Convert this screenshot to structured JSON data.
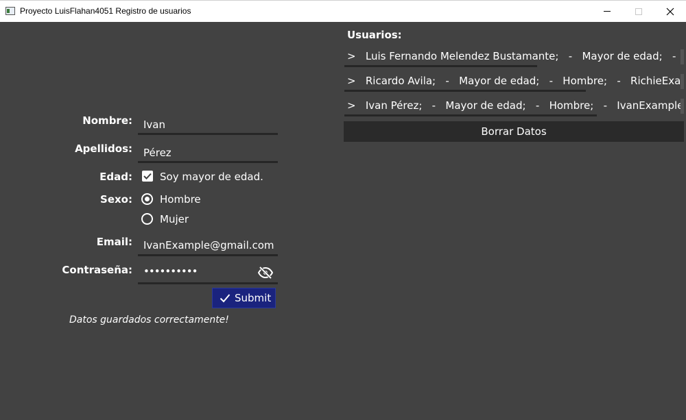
{
  "window": {
    "title": "Proyecto LuisFlahan4051 Registro de usuarios"
  },
  "form": {
    "nombre_label": "Nombre:",
    "nombre_value": "Ivan",
    "apellidos_label": "Apellidos:",
    "apellidos_value": "Pérez",
    "edad_label": "Edad:",
    "edad_option": "Soy mayor de edad.",
    "edad_checked": true,
    "sexo_label": "Sexo:",
    "sexo_options": [
      "Hombre",
      "Mujer"
    ],
    "sexo_selected": "Hombre",
    "email_label": "Email:",
    "email_value": "IvanExample@gmail.com",
    "password_label": "Contraseña:",
    "password_value": "••••••••••",
    "submit_label": "Submit",
    "status_message": "Datos guardados correctamente!"
  },
  "users": {
    "title": "Usuarios:",
    "rows": [
      ">   Luis Fernando Melendez Bustamante;   -   Mayor de edad;   -   Hombre;",
      ">   Ricardo Avila;   -   Mayor de edad;   -   Hombre;   -   RichieExample@gmail.com",
      ">   Ivan Pérez;   -   Mayor de edad;   -   Hombre;   -   IvanExample@gmail.com"
    ],
    "clear_label": "Borrar Datos"
  },
  "colors": {
    "background": "#424242",
    "accent": "#1a237e",
    "underline": "#262626"
  }
}
